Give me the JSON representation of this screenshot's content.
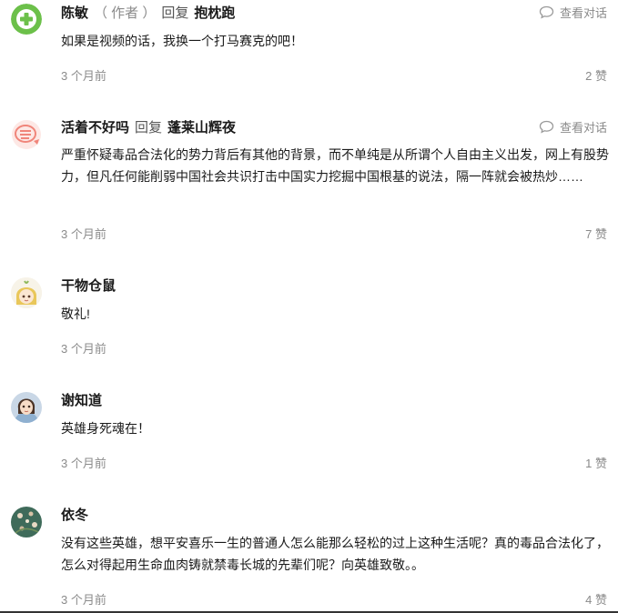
{
  "ui": {
    "view_conversation": "查看对话"
  },
  "comments": [
    {
      "author": "陈敏",
      "tag": "（ 作者 ）",
      "reply_word": "回复",
      "reply_to": "抱枕跑",
      "text": "如果是视频的话，我换一个打马赛克的吧！",
      "time": "3 个月前",
      "likes": "2 赞",
      "avatar": "green-plus-avatar"
    },
    {
      "author": "活着不好吗",
      "reply_word": "回复",
      "reply_to": "蓬莱山辉夜",
      "text": "严重怀疑毒品合法化的势力背后有其他的背景，而不单纯是从所谓个人自由主义出发，网上有股势力，但凡任何能削弱中国社会共识打击中国实力挖掘中国根基的说法，隔一阵就会被热炒……",
      "time": "3 个月前",
      "likes": "7 赞",
      "avatar": "red-fish-avatar"
    },
    {
      "author": "干物仓鼠",
      "text": "敬礼!",
      "time": "3 个月前",
      "avatar": "anime-girl-avatar"
    },
    {
      "author": "谢知道",
      "text": "英雄身死魂在！",
      "time": "3 个月前",
      "likes": "1 赞",
      "avatar": "portrait-avatar"
    },
    {
      "author": "依冬",
      "text": "没有这些英雄，想平安喜乐一生的普通人怎么能那么轻松的过上这种生活呢？真的毒品合法化了，怎么对得起用生命血肉铸就禁毒长城的先辈们呢？向英雄致敬。。",
      "time": "3 个月前",
      "likes": "4 赞",
      "avatar": "floral-avatar"
    }
  ],
  "colors": {
    "green": "#6cc04a",
    "red": "#f0857a",
    "gray": "#8a8a8a"
  }
}
